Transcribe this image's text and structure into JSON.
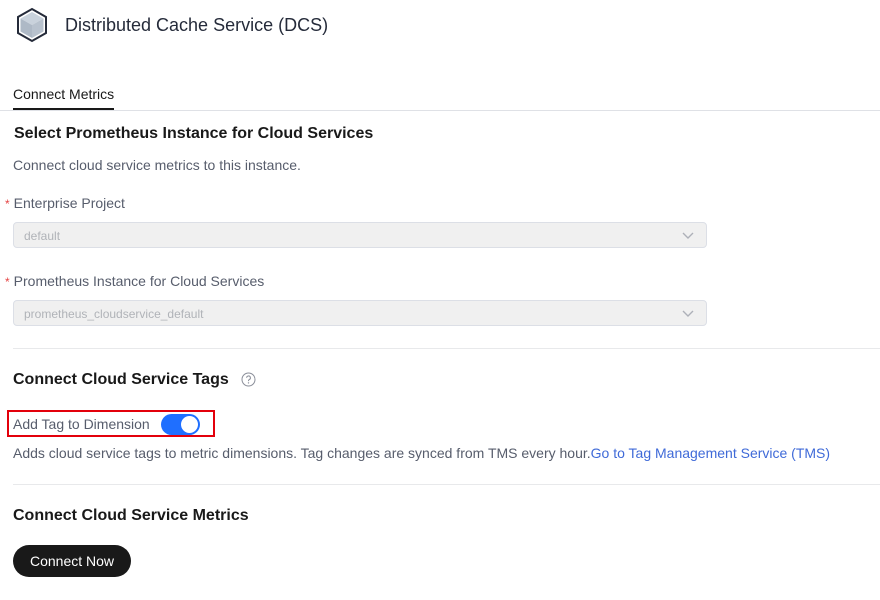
{
  "header": {
    "title": "Distributed Cache Service (DCS)",
    "logo_icon": "hexagon-cube-icon"
  },
  "tabs": [
    {
      "label": "Connect Metrics",
      "active": true
    }
  ],
  "instance_section": {
    "title": "Select Prometheus Instance for Cloud Services",
    "description": "Connect cloud service metrics to this instance.",
    "enterprise_project": {
      "required_mark": "*",
      "label": "Enterprise Project",
      "value": "default"
    },
    "prometheus_instance": {
      "required_mark": "*",
      "label": "Prometheus Instance for Cloud Services",
      "value": "prometheus_cloudservice_default"
    }
  },
  "tags_section": {
    "title": "Connect Cloud Service Tags",
    "toggle_label": "Add Tag to Dimension",
    "toggle_on": true,
    "description": "Adds cloud service tags to metric dimensions. Tag changes are synced from TMS every hour.",
    "link_text": "Go to Tag Management Service (TMS)"
  },
  "metrics_section": {
    "title": "Connect Cloud Service Metrics",
    "button_label": "Connect Now"
  },
  "colors": {
    "accent": "#1f6fff",
    "link": "#3f6ad8",
    "highlight": "#e3000b",
    "button_bg": "#191919"
  }
}
